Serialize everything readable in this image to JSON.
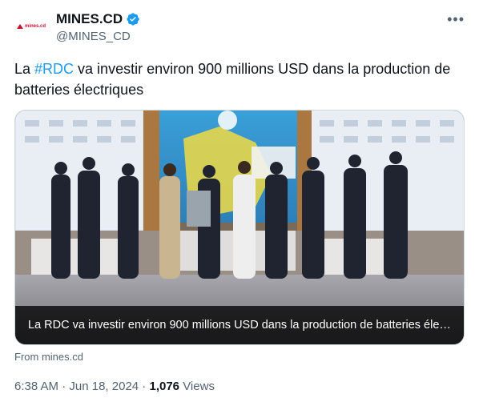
{
  "author": {
    "display_name": "MINES.CD",
    "handle": "@MINES_CD",
    "avatar_text": "mines.cd",
    "verified": true
  },
  "more_label": "•••",
  "tweet": {
    "prefix": "La ",
    "hashtag": "#RDC",
    "suffix": " va investir environ 900 millions USD dans la production de batteries électriques"
  },
  "media": {
    "caption": "La RDC va investir environ 900 millions USD dans la production de batteries élec..."
  },
  "link_source": "From mines.cd",
  "meta": {
    "time": "6:38 AM",
    "separator": " · ",
    "date": "Jun 18, 2024",
    "views_count": "1,076",
    "views_label": " Views"
  },
  "colors": {
    "accent": "#1d9bf0",
    "text": "#0f1419",
    "secondary": "#536471"
  }
}
